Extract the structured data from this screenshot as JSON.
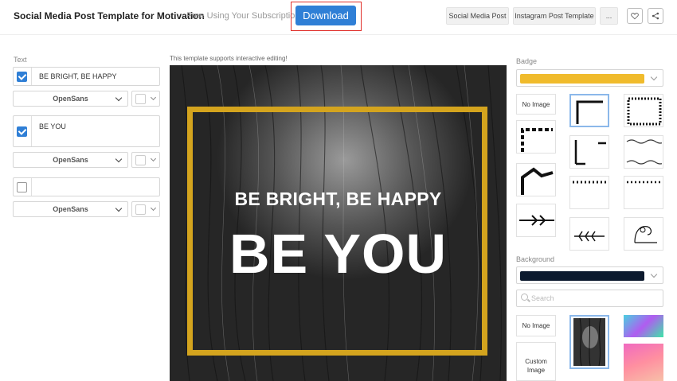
{
  "header": {
    "title": "Social Media Post Template for Motivation",
    "subscription_note": "Free Using Your Subscription!",
    "download_label": "Download",
    "chips": [
      "Social Media Post",
      "Instagram Post Template",
      "..."
    ]
  },
  "text_panel": {
    "label": "Text",
    "rows": [
      {
        "checked": true,
        "value": "BE BRIGHT, BE HAPPY",
        "font": "OpenSans"
      },
      {
        "checked": true,
        "value": "BE YOU",
        "font": "OpenSans"
      },
      {
        "checked": false,
        "value": "",
        "font": "OpenSans"
      }
    ]
  },
  "canvas": {
    "note": "This template supports interactive editing!",
    "line1": "BE BRIGHT, BE HAPPY",
    "line2": "BE YOU",
    "frame_color": "#d4a41e"
  },
  "badge_panel": {
    "label": "Badge",
    "selected_color": "#f0bb2c",
    "no_image_label": "No Image"
  },
  "background_panel": {
    "label": "Background",
    "selected_color": "#0c1a2e",
    "search_placeholder": "Search",
    "no_image_label": "No Image",
    "custom_image_label": "Custom Image"
  },
  "colors": {
    "accent": "#2f7fd6",
    "highlight_frame": "#e0302a"
  }
}
